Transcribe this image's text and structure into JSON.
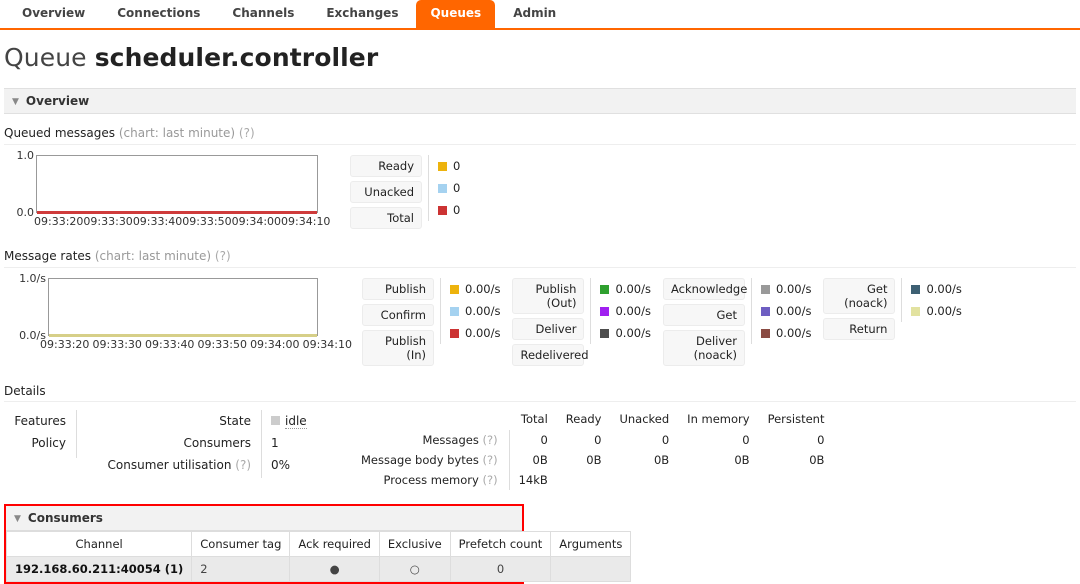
{
  "nav": {
    "tabs": [
      {
        "label": "Overview",
        "active": false
      },
      {
        "label": "Connections",
        "active": false
      },
      {
        "label": "Channels",
        "active": false
      },
      {
        "label": "Exchanges",
        "active": false
      },
      {
        "label": "Queues",
        "active": true
      },
      {
        "label": "Admin",
        "active": false
      }
    ]
  },
  "page": {
    "title_prefix": "Queue",
    "title_name": "scheduler.controller"
  },
  "overview": {
    "section_label": "Overview",
    "queued": {
      "label": "Queued messages",
      "chart_note": "(chart: last minute)",
      "help": "(?)",
      "y_top": "1.0",
      "y_bottom": "0.0",
      "x_ticks": [
        "09:33:20",
        "09:33:30",
        "09:33:40",
        "09:33:50",
        "09:34:00",
        "09:34:10"
      ],
      "baseline_color": "#cf3b3b",
      "legend": [
        {
          "label": "Ready",
          "value": "0",
          "color": "#edb30d"
        },
        {
          "label": "Unacked",
          "value": "0",
          "color": "#a5d2f0"
        },
        {
          "label": "Total",
          "value": "0",
          "color": "#cc3333"
        }
      ]
    },
    "rates": {
      "label": "Message rates",
      "chart_note": "(chart: last minute)",
      "help": "(?)",
      "y_top": "1.0/s",
      "y_bottom": "0.0/s",
      "x_ticks": [
        "09:33:20",
        "09:33:30",
        "09:33:40",
        "09:33:50",
        "09:34:00",
        "09:34:10"
      ],
      "baseline_color": "#d6cf88",
      "legend_groups": [
        [
          {
            "label": "Publish",
            "value": "0.00/s",
            "color": "#edb30d"
          },
          {
            "label": "Confirm",
            "value": "0.00/s",
            "color": "#a5d2f0"
          },
          {
            "label": "Publish (In)",
            "value": "0.00/s",
            "color": "#cc3333"
          }
        ],
        [
          {
            "label": "Publish (Out)",
            "value": "0.00/s",
            "color": "#2fa02f"
          },
          {
            "label": "Deliver",
            "value": "0.00/s",
            "color": "#a020f0"
          },
          {
            "label": "Redelivered",
            "value": "0.00/s",
            "color": "#4d4d4d"
          }
        ],
        [
          {
            "label": "Acknowledge",
            "value": "0.00/s",
            "color": "#999999"
          },
          {
            "label": "Get",
            "value": "0.00/s",
            "color": "#6e5ec2"
          },
          {
            "label": "Deliver (noack)",
            "value": "0.00/s",
            "color": "#8a4b43"
          }
        ],
        [
          {
            "label": "Get (noack)",
            "value": "0.00/s",
            "color": "#3d6073"
          },
          {
            "label": "Return",
            "value": "0.00/s",
            "color": "#e2e2a0"
          }
        ]
      ]
    }
  },
  "details": {
    "label": "Details",
    "left_keys": [
      "Features",
      "Policy"
    ],
    "mid": [
      {
        "key": "State",
        "value": "idle",
        "is_state": true
      },
      {
        "key": "Consumers",
        "value": "1",
        "is_state": false
      },
      {
        "key": "Consumer utilisation",
        "help": "(?)",
        "value": "0%",
        "is_state": false
      }
    ],
    "stats": {
      "columns": [
        "Total",
        "Ready",
        "Unacked",
        "In memory",
        "Persistent"
      ],
      "rows": [
        {
          "key": "Messages",
          "help": "(?)",
          "values": [
            "0",
            "0",
            "0",
            "0",
            "0"
          ]
        },
        {
          "key": "Message body bytes",
          "help": "(?)",
          "values": [
            "0B",
            "0B",
            "0B",
            "0B",
            "0B"
          ]
        },
        {
          "key": "Process memory",
          "help": "(?)",
          "values": [
            "14kB",
            "",
            "",
            "",
            ""
          ]
        }
      ]
    }
  },
  "consumers": {
    "section_label": "Consumers",
    "columns": [
      "Channel",
      "Consumer tag",
      "Ack required",
      "Exclusive",
      "Prefetch count",
      "Arguments"
    ],
    "rows": [
      {
        "channel": "192.168.60.211:40054 (1)",
        "consumer_tag": "2",
        "ack_required": "●",
        "exclusive": "○",
        "prefetch_count": "0",
        "arguments": ""
      }
    ],
    "highlight_color": "#ff0000"
  }
}
